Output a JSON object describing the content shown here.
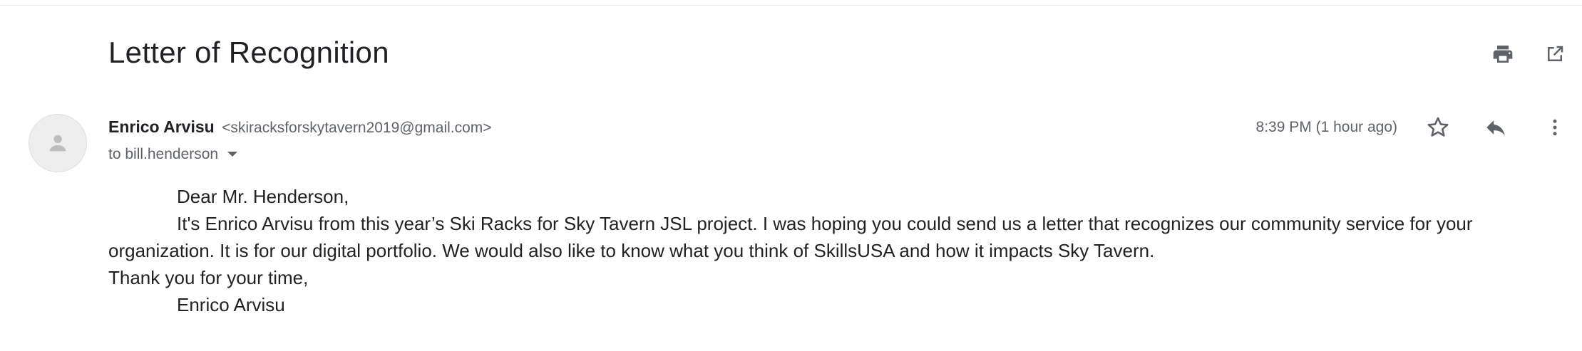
{
  "email": {
    "subject": "Letter of Recognition",
    "sender_name": "Enrico Arvisu",
    "sender_email": "<skiracksforskytavern2019@gmail.com>",
    "recipient_line": "to bill.henderson",
    "timestamp": "8:39 PM (1 hour ago)",
    "body": {
      "greeting": "Dear Mr. Henderson,",
      "paragraph": "It's Enrico Arvisu from this year’s Ski Racks for Sky Tavern JSL project. I was hoping you could send us a letter that recognizes our community service for your organization. It is for our digital portfolio. We would also like to know what you think of SkillsUSA and how it impacts Sky Tavern.",
      "closing": "Thank you for your time,",
      "signature": "Enrico Arvisu"
    }
  },
  "icons": {
    "print": "print-icon",
    "popout": "open-in-new-window-icon",
    "avatar": "person-icon",
    "recipient_details": "chevron-down-icon",
    "star": "star-outline-icon",
    "reply": "reply-icon",
    "more": "more-vert-icon"
  },
  "colors": {
    "text_primary": "#202124",
    "text_secondary": "#5f6368",
    "icon": "#5f6368",
    "avatar_bg": "#eeeeee"
  }
}
